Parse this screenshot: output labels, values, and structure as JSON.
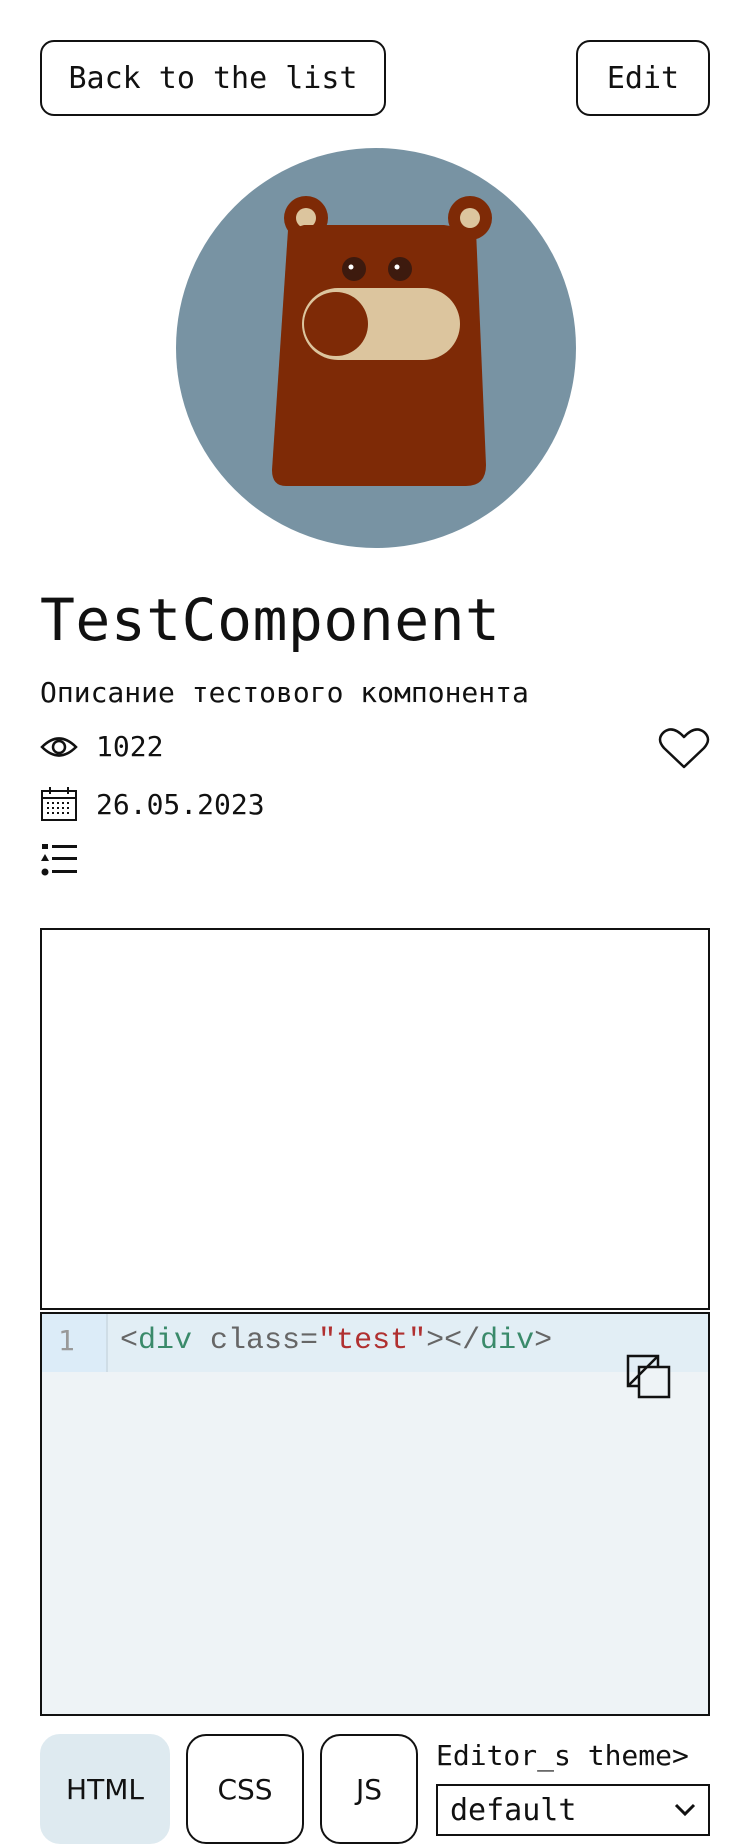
{
  "header": {
    "back_label": "Back to the list",
    "edit_label": "Edit"
  },
  "component": {
    "title": "TestComponent",
    "description": "Описание тестового компонента",
    "views": "1022",
    "date": "26.05.2023"
  },
  "editor": {
    "line_number": "1",
    "code_tokens": [
      "<",
      "div",
      " class=",
      "\"test\"",
      "></",
      "div",
      ">"
    ]
  },
  "tabs": {
    "html": "HTML",
    "css": "CSS",
    "js": "JS"
  },
  "theme": {
    "label": "Editor_s theme>",
    "selected": "default"
  },
  "colors": {
    "avatar_bg": "#7893a3",
    "bear_body": "#7e2a06",
    "bear_snout": "#dcc59e",
    "editor_bg": "#eef3f6",
    "active_tab_bg": "#deeaf0"
  },
  "icons": [
    "eye-icon",
    "heart-icon",
    "calendar-icon",
    "list-icon",
    "copy-icon",
    "chevron-down-icon"
  ]
}
